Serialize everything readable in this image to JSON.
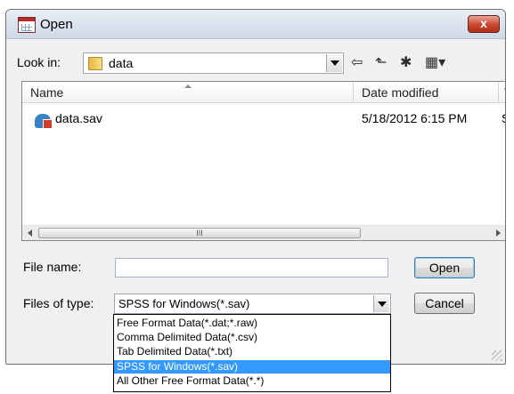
{
  "window": {
    "title": "Open",
    "close_glyph": "x",
    "icon": "spss-app-icon"
  },
  "toolbar": {
    "look_in_label": "Look in:",
    "look_in_value": "data",
    "back_glyph": "⇦",
    "up_glyph": "⬑",
    "new_folder_glyph": "✱",
    "views_glyph": "▦▾"
  },
  "filelist": {
    "columns": [
      "Name",
      "Date modified",
      "Ty"
    ],
    "rows": [
      {
        "name": "data.sav",
        "date": "5/18/2012 6:15 PM",
        "type": "SF"
      }
    ],
    "scroll_thumb_glyph": "III"
  },
  "form": {
    "file_name_label": "File name:",
    "file_name_value": "",
    "files_of_type_label": "Files of type:",
    "files_of_type_value": "SPSS for Windows(*.sav)"
  },
  "buttons": {
    "open": "Open",
    "cancel": "Cancel"
  },
  "type_options": [
    "Free Format Data(*.dat;*.raw)",
    "Comma Delimited Data(*.csv)",
    "Tab Delimited Data(*.txt)",
    "SPSS for Windows(*.sav)",
    "All Other Free Format Data(*.*)"
  ],
  "selected_option_index": 3,
  "colors": {
    "selection": "#3399ff",
    "close_button": "#c9452c"
  }
}
